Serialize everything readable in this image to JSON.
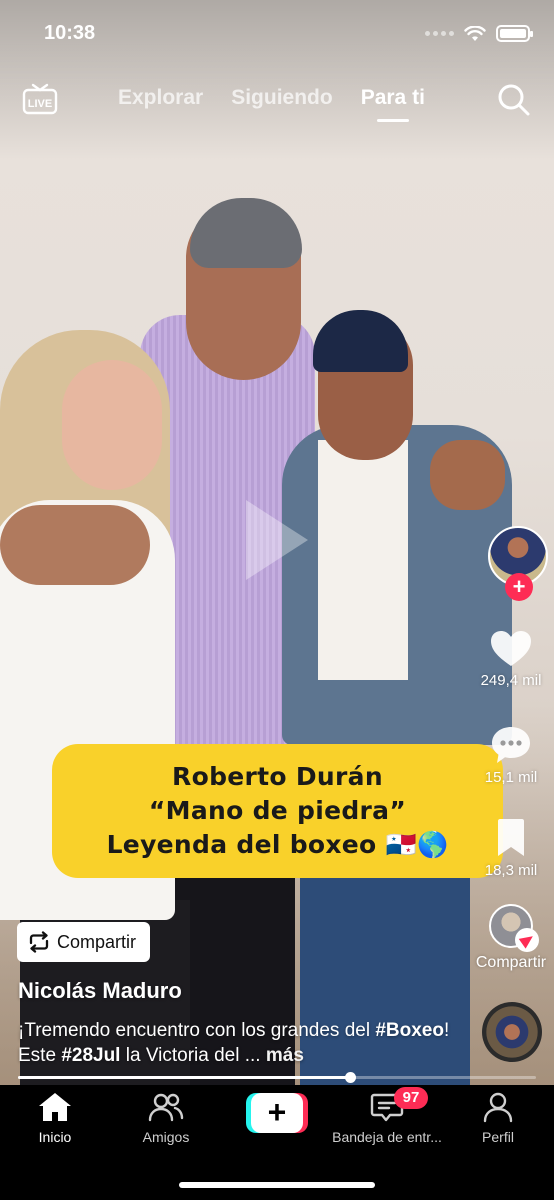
{
  "status_bar": {
    "time": "10:38"
  },
  "top_nav": {
    "live_label": "LIVE",
    "tabs": [
      {
        "label": "Explorar",
        "active": false
      },
      {
        "label": "Siguiendo",
        "active": false
      },
      {
        "label": "Para ti",
        "active": true
      }
    ]
  },
  "video": {
    "caption_lines": [
      "Roberto Durán",
      "“Mano de piedra”",
      "Leyenda del boxeo 🇵🇦🌎"
    ],
    "progress_percent": 64
  },
  "actions": {
    "likes": "249,4 mil",
    "comments": "15,1 mil",
    "saves": "18,3 mil",
    "share_label": "Compartir"
  },
  "post": {
    "share_button_label": "Compartir",
    "author": "Nicolás Maduro",
    "description_parts": [
      {
        "text": "¡Tremendo encuentro con los grandes del ",
        "bold": false
      },
      {
        "text": "#Boxeo",
        "bold": true
      },
      {
        "text": "! Este ",
        "bold": false
      },
      {
        "text": "#28Jul",
        "bold": true
      },
      {
        "text": " la Victoria del ... ",
        "bold": false
      }
    ],
    "more_label": "más"
  },
  "tab_bar": {
    "home": "Inicio",
    "friends": "Amigos",
    "inbox": "Bandeja de entr...",
    "inbox_badge": "97",
    "profile": "Perfil"
  },
  "colors": {
    "accent_red": "#fe2c55",
    "accent_cyan": "#25f4ee",
    "caption_yellow": "#f9d12a"
  }
}
